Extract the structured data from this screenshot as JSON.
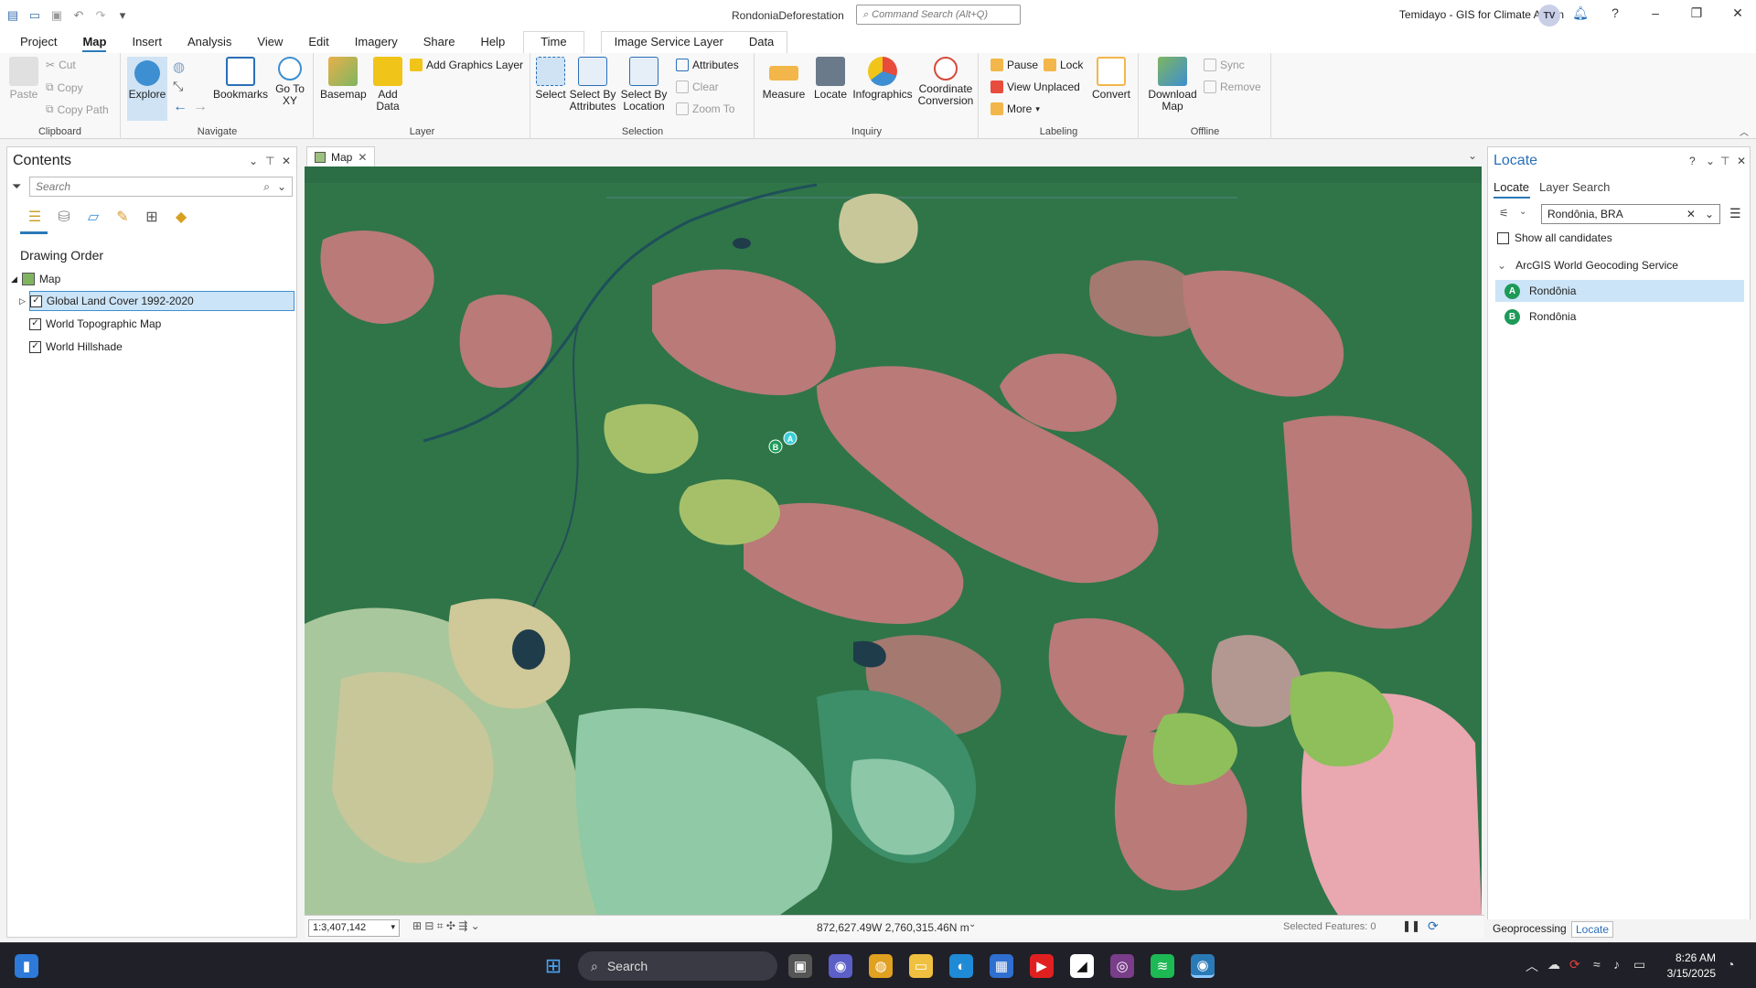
{
  "window": {
    "doc_title": "RondoniaDeforestation",
    "command_search_placeholder": "Command Search (Alt+Q)",
    "user": "Temidayo - GIS for Climate Action",
    "avatar": "TV"
  },
  "tabs": [
    "Project",
    "Map",
    "Insert",
    "Analysis",
    "View",
    "Edit",
    "Imagery",
    "Share",
    "Help",
    "Time",
    "Image Service Layer",
    "Data"
  ],
  "active_tab": "Map",
  "ribbon": {
    "clipboard": {
      "label": "Clipboard",
      "paste": "Paste",
      "cut": "Cut",
      "copy": "Copy",
      "copy_path": "Copy Path"
    },
    "navigate": {
      "label": "Navigate",
      "explore": "Explore",
      "bookmarks": "Bookmarks",
      "go_to_xy": "Go To XY"
    },
    "layer": {
      "label": "Layer",
      "basemap": "Basemap",
      "add_data": "Add Data",
      "add_graphics_layer": "Add Graphics Layer"
    },
    "selection": {
      "label": "Selection",
      "select": "Select",
      "select_by_attributes": "Select By Attributes",
      "select_by_location": "Select By Location",
      "attributes": "Attributes",
      "clear": "Clear",
      "zoom_to": "Zoom To"
    },
    "inquiry": {
      "label": "Inquiry",
      "measure": "Measure",
      "locate": "Locate",
      "infographics": "Infographics",
      "coordinate_conversion": "Coordinate Conversion"
    },
    "labeling": {
      "label": "Labeling",
      "pause": "Pause",
      "lock": "Lock",
      "view_unplaced": "View Unplaced",
      "more": "More",
      "convert": "Convert"
    },
    "offline": {
      "label": "Offline",
      "download_map": "Download Map",
      "sync": "Sync",
      "remove": "Remove"
    }
  },
  "contents": {
    "title": "Contents",
    "search_placeholder": "Search",
    "drawing_order": "Drawing Order",
    "map_node": "Map",
    "layers": [
      "Global Land Cover 1992-2020",
      "World Topographic Map",
      "World Hillshade"
    ]
  },
  "map": {
    "tab_label": "Map",
    "scale": "1:3,407,142",
    "coordinates": "872,627.49W 2,760,315.46N m",
    "selected_features": "Selected Features: 0",
    "markers": [
      "A",
      "B"
    ],
    "colors": {
      "forest": "#2f7548",
      "deforested": "#b97a78",
      "grassland": "#a6c06a",
      "savanna": "#c8c79a",
      "water": "#1f4a5a",
      "light_pink": "#e9a7b0"
    }
  },
  "locate": {
    "title": "Locate",
    "tabs": [
      "Locate",
      "Layer Search"
    ],
    "query": "Rondônia, BRA",
    "show_all": "Show all candidates",
    "provider": "ArcGIS World Geocoding Service",
    "candidates": [
      {
        "pin": "A",
        "name": "Rondônia"
      },
      {
        "pin": "B",
        "name": "Rondônia"
      }
    ]
  },
  "bottom_tabs": [
    "Geoprocessing",
    "Locate"
  ],
  "taskbar": {
    "search": "Search",
    "time": "8:26 AM",
    "date": "3/15/2025"
  }
}
